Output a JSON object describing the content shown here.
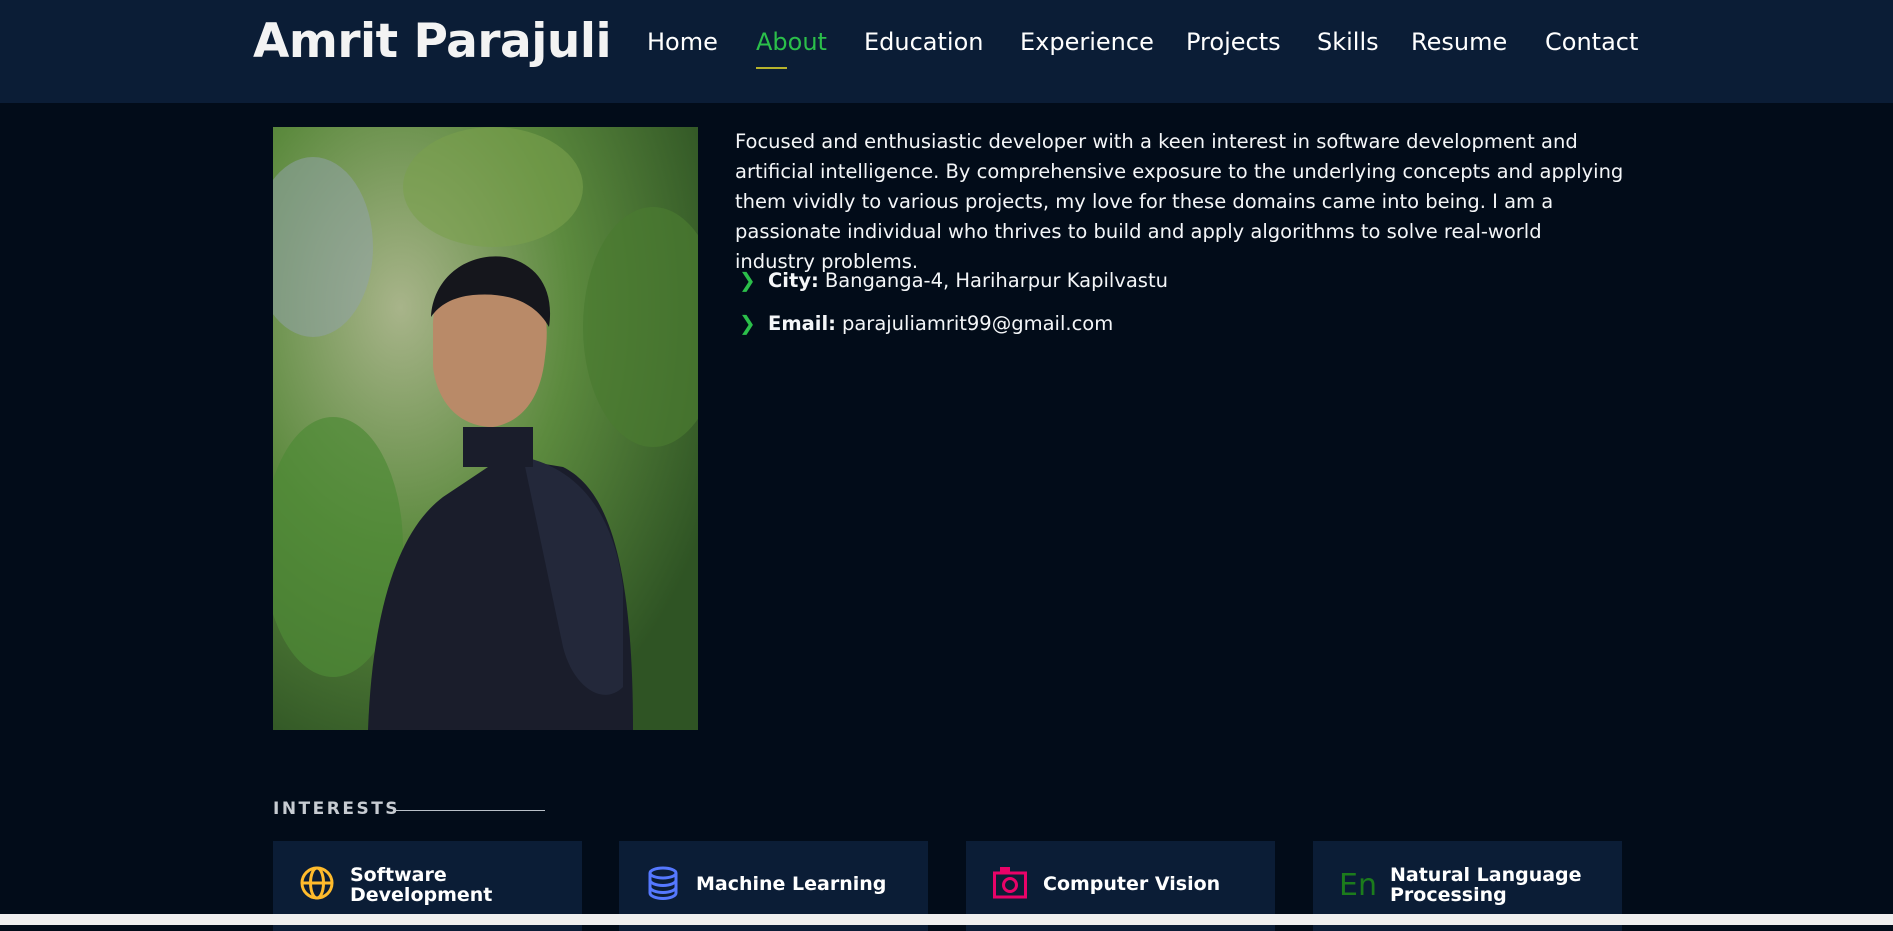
{
  "header": {
    "logo": "Amrit Parajuli",
    "nav": [
      {
        "label": "Home"
      },
      {
        "label": "About"
      },
      {
        "label": "Education"
      },
      {
        "label": "Experience"
      },
      {
        "label": "Projects"
      },
      {
        "label": "Skills"
      },
      {
        "label": "Resume"
      },
      {
        "label": "Contact"
      }
    ],
    "active_nav": "About"
  },
  "about": {
    "bio": "Focused and enthusiastic developer with a keen interest in software development and artificial intelligence. By comprehensive exposure to the underlying concepts and applying them vividly to various projects, my love for these domains came into being. I am a passionate individual who thrives to build and apply algorithms to solve real-world industry problems.",
    "details": [
      {
        "label": "City:",
        "value": "Banganga-4, Hariharpur Kapilvastu"
      },
      {
        "label": "Email:",
        "value": "parajuliamrit99@gmail.com"
      }
    ]
  },
  "interests": {
    "title": "INTERESTS",
    "items": [
      {
        "label": "Software Development",
        "icon": "globe-icon",
        "color": "#ffbb2c"
      },
      {
        "label": "Machine Learning",
        "icon": "database-icon",
        "color": "#5578ff"
      },
      {
        "label": "Computer Vision",
        "icon": "camera-icon",
        "color": "#e80368"
      },
      {
        "label": "Natural Language Processing",
        "icon": "language-icon",
        "color": "#1c7c1c"
      }
    ]
  },
  "colors": {
    "background": "#020c19",
    "header": "#0b1d36",
    "accent": "#2bbf4a"
  }
}
